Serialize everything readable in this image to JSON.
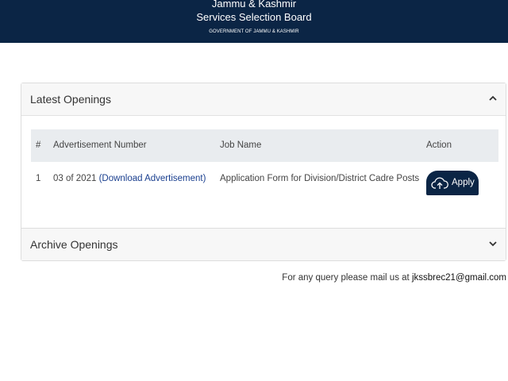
{
  "header": {
    "line1": "Jammu & Kashmir",
    "line2": "Services Selection Board",
    "line3": "GOVERNMENT OF JAMMU & KASHMIR"
  },
  "latest": {
    "title": "Latest Openings",
    "columns": [
      "#",
      "Advertisement Number",
      "Job Name",
      "Action"
    ],
    "rows": [
      {
        "num": "1",
        "adv_number": "03 of 2021",
        "download_link": "(Download Advertisement)",
        "job_name": "Application Form for Division/District Cadre Posts",
        "action_label": "Apply"
      }
    ]
  },
  "archive": {
    "title": "Archive Openings"
  },
  "footer": {
    "query_text": "For any query please mail us at",
    "email": "jkssbrec21@gmail.com"
  },
  "colors": {
    "header_bg": "#0b2545",
    "button_bg": "#0b2545",
    "link": "#1a3f8f"
  },
  "icons": [
    "chevron-up-icon",
    "chevron-down-icon",
    "cloud-upload-icon"
  ]
}
